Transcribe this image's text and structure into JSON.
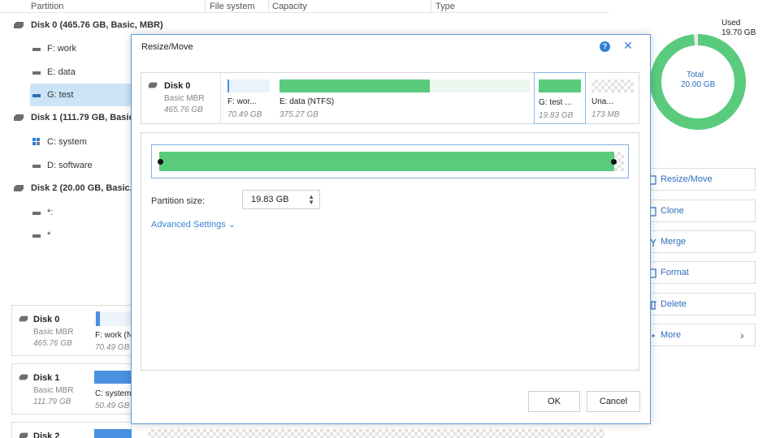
{
  "tree": {
    "columns": [
      "Partition",
      "File system",
      "Capacity",
      "Type"
    ],
    "rows": [
      {
        "kind": "disk",
        "label": "Disk 0 (465.76 GB, Basic, MBR)"
      },
      {
        "kind": "part",
        "label": "F: work"
      },
      {
        "kind": "part",
        "label": "E: data"
      },
      {
        "kind": "part",
        "label": "G: test",
        "selected": true
      },
      {
        "kind": "disk",
        "label": "Disk 1 (111.79 GB, Basic,"
      },
      {
        "kind": "part",
        "label": "C: system",
        "icon": "windows-icon"
      },
      {
        "kind": "part",
        "label": "D: software"
      },
      {
        "kind": "disk",
        "label": "Disk 2 (20.00 GB, Basic, G"
      },
      {
        "kind": "part",
        "label": "*:"
      },
      {
        "kind": "part",
        "label": "*"
      }
    ]
  },
  "diskmap": [
    {
      "name": "Disk 0",
      "type": "Basic MBR",
      "size": "465.76 GB",
      "part_label": "F: work (N",
      "part_size": "70.49 GB"
    },
    {
      "name": "Disk 1",
      "type": "Basic MBR",
      "size": "111.79 GB",
      "part_label": "C: system",
      "part_size": "50.49 GB"
    },
    {
      "name": "Disk 2"
    }
  ],
  "usage": {
    "used_label": "Used",
    "used_value": "19.70 GB",
    "total_label": "Total",
    "total_value": "20.00 GB",
    "used_fraction": 0.985,
    "color": "#5acb7d"
  },
  "actions": [
    {
      "label": "Resize/Move",
      "icon": "resize-icon"
    },
    {
      "label": "Clone",
      "icon": "clone-icon"
    },
    {
      "label": "Merge",
      "icon": "merge-icon"
    },
    {
      "label": "Format",
      "icon": "format-icon"
    },
    {
      "label": "Delete",
      "icon": "delete-icon"
    },
    {
      "label": "More",
      "icon": "more-icon",
      "chevron": "›"
    }
  ],
  "dialog": {
    "title": "Resize/Move",
    "help": "?",
    "close": "✕",
    "disk": {
      "name": "Disk 0",
      "type": "Basic MBR",
      "size": "465.76 GB"
    },
    "segments": [
      {
        "label": "F: wor...",
        "size": "70.49 GB",
        "fill": 0.04,
        "color": "#4a90e2"
      },
      {
        "label": "E: data (NTFS)",
        "size": "375.27 GB",
        "fill": 0.6,
        "color": "#5acb7d"
      },
      {
        "label": "G: test ...",
        "size": "19.83 GB",
        "fill": 1.0,
        "color": "#5acb7d",
        "selected": true
      },
      {
        "label": "Una...",
        "size": "173 MB",
        "unallocated": true
      }
    ],
    "slider": {
      "fill_fraction": 0.985
    },
    "partition_size_label": "Partition size:",
    "partition_size_value": "19.83 GB",
    "spin_up": "▲",
    "spin_down": "▼",
    "advanced_label": "Advanced Settings ⌄",
    "ok_label": "OK",
    "cancel_label": "Cancel"
  },
  "colors": {
    "accent": "#2f7fd8",
    "green": "#5acb7d",
    "blue": "#4a90e2",
    "selection": "#cce4f7"
  }
}
